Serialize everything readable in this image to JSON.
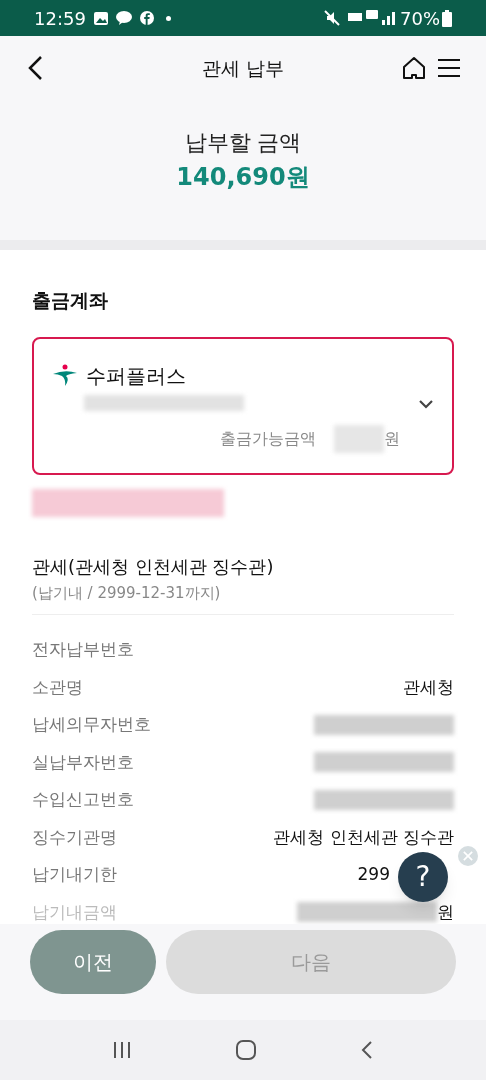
{
  "status_bar": {
    "time": "12:59",
    "battery": "70%"
  },
  "header": {
    "title": "관세 납부"
  },
  "amount": {
    "label": "납부할 금액",
    "value": "140,690원"
  },
  "account": {
    "section_title": "출금계좌",
    "bank_name": "수퍼플러스",
    "available_label": "출금가능금액",
    "available_unit": "원"
  },
  "tax": {
    "title": "관세(관세청 인천세관 징수관)",
    "subtitle": "(납기내 / 2999-12-31까지)"
  },
  "details": [
    {
      "label": "전자납부번호",
      "kind": "empty"
    },
    {
      "label": "소관명",
      "kind": "text",
      "value": "관세청"
    },
    {
      "label": "납세의무자번호",
      "kind": "blurred"
    },
    {
      "label": "실납부자번호",
      "kind": "blurred"
    },
    {
      "label": "수입신고번호",
      "kind": "blurred"
    },
    {
      "label": "징수기관명",
      "kind": "text",
      "value": "관세청 인천세관 징수관"
    },
    {
      "label": "납기내기한",
      "kind": "covered",
      "value": "299"
    },
    {
      "label": "납기내금액",
      "kind": "blurred",
      "unit": "원"
    }
  ],
  "help_button": {
    "label": "?"
  },
  "buttons": [
    {
      "label": "이전",
      "disabled": false
    },
    {
      "label": "다음",
      "disabled": true
    }
  ]
}
